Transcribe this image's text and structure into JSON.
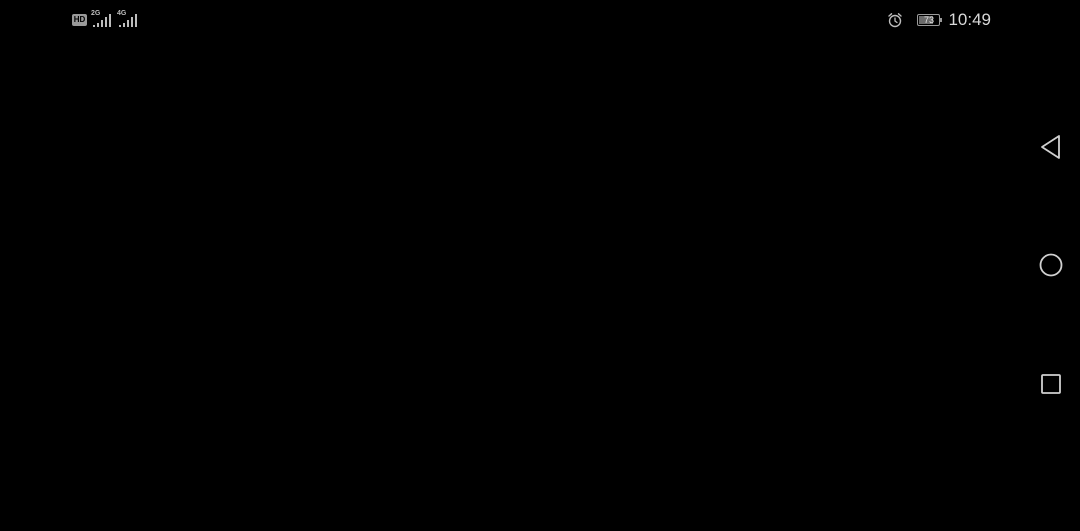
{
  "status_bar": {
    "hd_label": "HD",
    "sim1_network": "2G",
    "sim2_network": "4G",
    "battery_percent": "73",
    "battery_level": 0.73,
    "time": "10:49",
    "alarm_icon": "alarm-clock-icon"
  },
  "nav_bar": {
    "back_icon": "back-triangle-icon",
    "home_icon": "home-circle-icon",
    "recents_icon": "recents-square-icon"
  },
  "colors": {
    "background": "#000000",
    "icon": "#d0d0d0"
  }
}
